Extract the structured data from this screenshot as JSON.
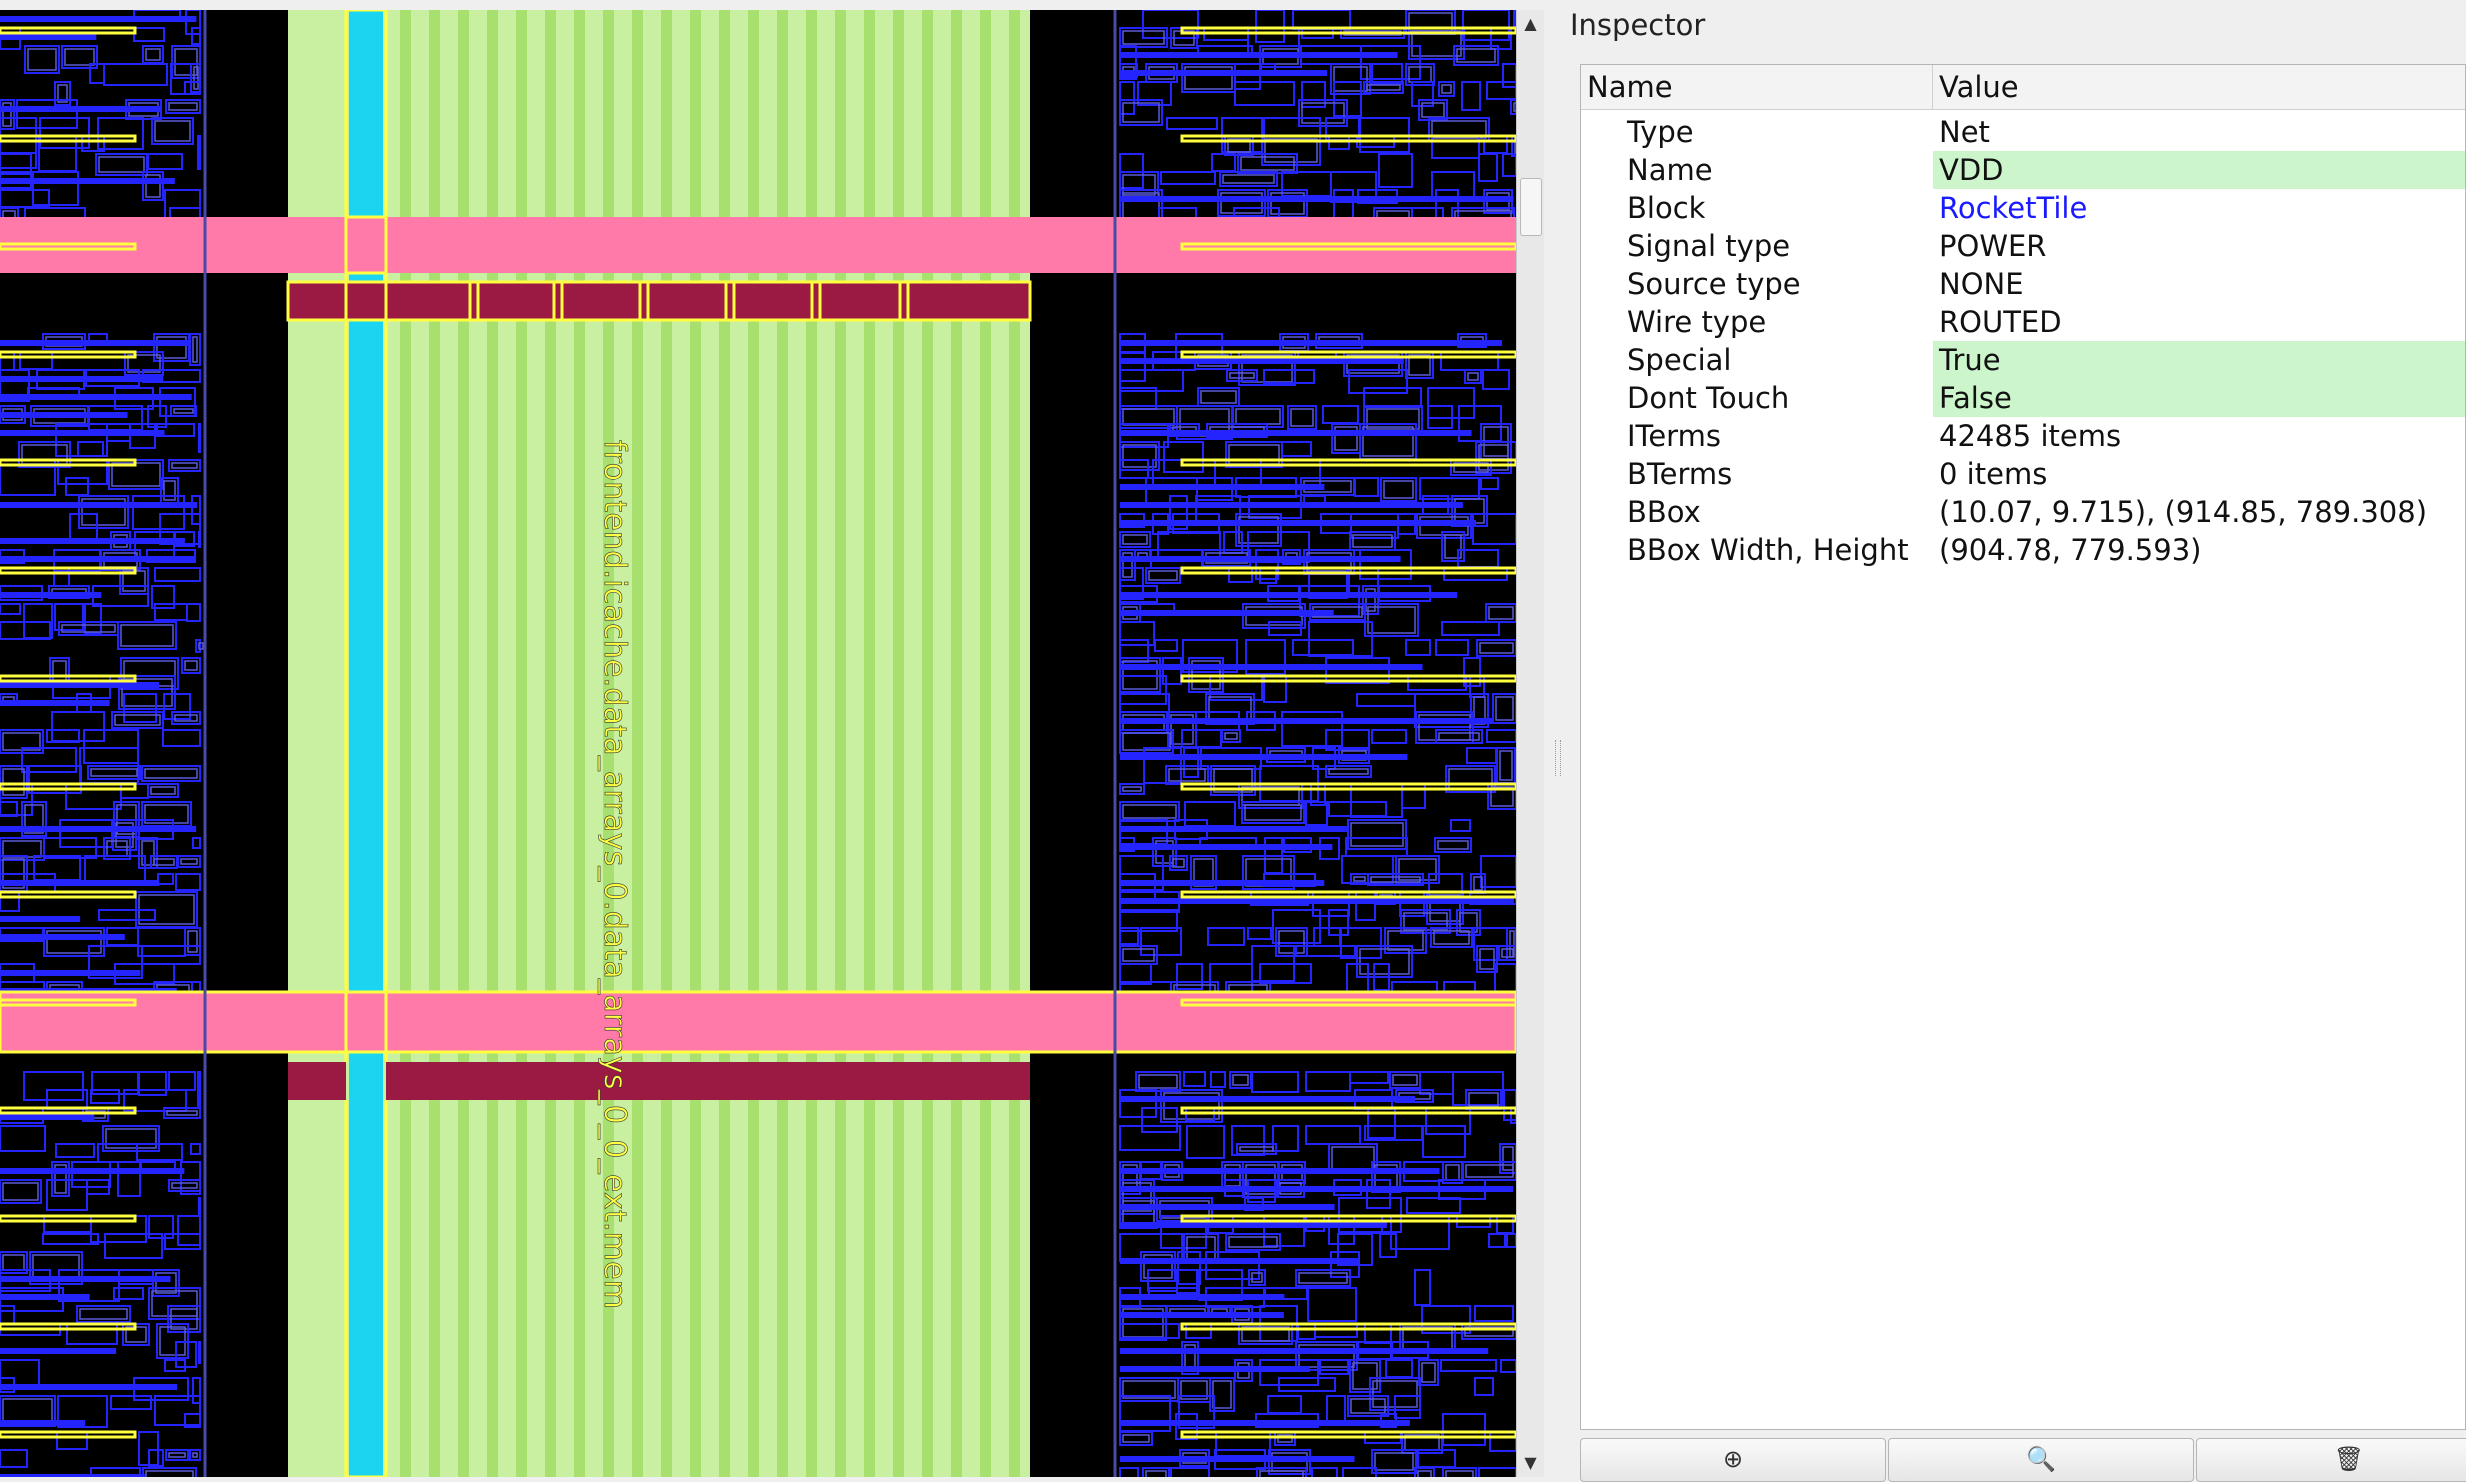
{
  "inspector": {
    "title": "Inspector",
    "columns": {
      "name": "Name",
      "value": "Value"
    },
    "rows": [
      {
        "name": "Type",
        "value": "Net",
        "style": "plain"
      },
      {
        "name": "Name",
        "value": "VDD",
        "style": "highlight"
      },
      {
        "name": "Block",
        "value": "RocketTile",
        "style": "link"
      },
      {
        "name": "Signal type",
        "value": "POWER",
        "style": "plain"
      },
      {
        "name": "Source type",
        "value": "NONE",
        "style": "plain"
      },
      {
        "name": "Wire type",
        "value": "ROUTED",
        "style": "plain"
      },
      {
        "name": "Special",
        "value": "True",
        "style": "highlight"
      },
      {
        "name": "Dont Touch",
        "value": "False",
        "style": "highlight"
      },
      {
        "name": "ITerms",
        "value": "42485 items",
        "style": "plain"
      },
      {
        "name": "BTerms",
        "value": "0 items",
        "style": "plain"
      },
      {
        "name": "BBox",
        "value": "(10.07, 9.715), (914.85, 789.308)",
        "style": "plain"
      },
      {
        "name": "BBox Width, Height",
        "value": "(904.78, 779.593)",
        "style": "plain"
      }
    ],
    "buttons": [
      {
        "icon": "zoom-in-icon",
        "glyph": "⊕"
      },
      {
        "icon": "magnifier-icon",
        "glyph": "🔍"
      },
      {
        "icon": "highlight-icon",
        "glyph": "🗑"
      }
    ]
  },
  "layout": {
    "instance_label": "frontend.icache.data_arrays_0.data_arrays_0_0_ext.mem",
    "colors": {
      "background": "#000000",
      "macro_fill": "#c8f0a0",
      "macro_stripe": "#a8e070",
      "power_strap": "#ff7aa8",
      "power_rail": "#9a1a44",
      "vertical_strap": "#1ad4f0",
      "cell_outline": "#2424ff",
      "highlight_outline": "#ffff40"
    }
  }
}
